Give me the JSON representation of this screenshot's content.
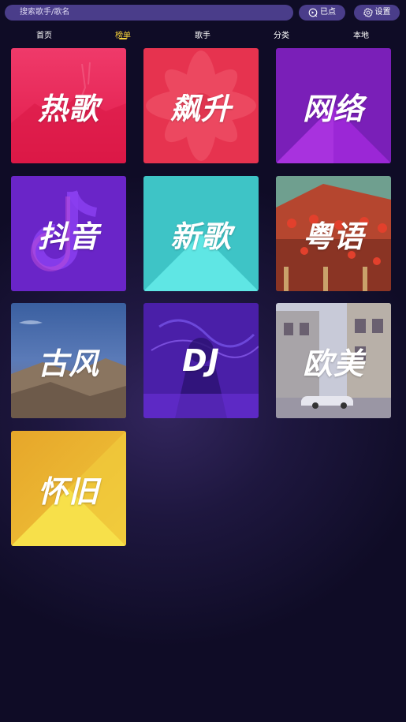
{
  "search": {
    "placeholder": "搜索歌手/歌名"
  },
  "buttons": {
    "played_label": "已点",
    "settings_label": "设置"
  },
  "tabs": [
    {
      "label": "首页"
    },
    {
      "label": "榜单"
    },
    {
      "label": "歌手"
    },
    {
      "label": "分类"
    },
    {
      "label": "本地"
    }
  ],
  "active_tab": "榜单",
  "categories": [
    {
      "label": "热歌"
    },
    {
      "label": "飙升"
    },
    {
      "label": "网络"
    },
    {
      "label": "抖音"
    },
    {
      "label": "新歌"
    },
    {
      "label": "粤语"
    },
    {
      "label": "古风"
    },
    {
      "label": "DJ"
    },
    {
      "label": "欧美"
    },
    {
      "label": "怀旧"
    }
  ],
  "colors": {
    "accent": "#f4cf3a",
    "pill_bg": "#4a3d8a",
    "page_bg": "#0f0c26"
  }
}
